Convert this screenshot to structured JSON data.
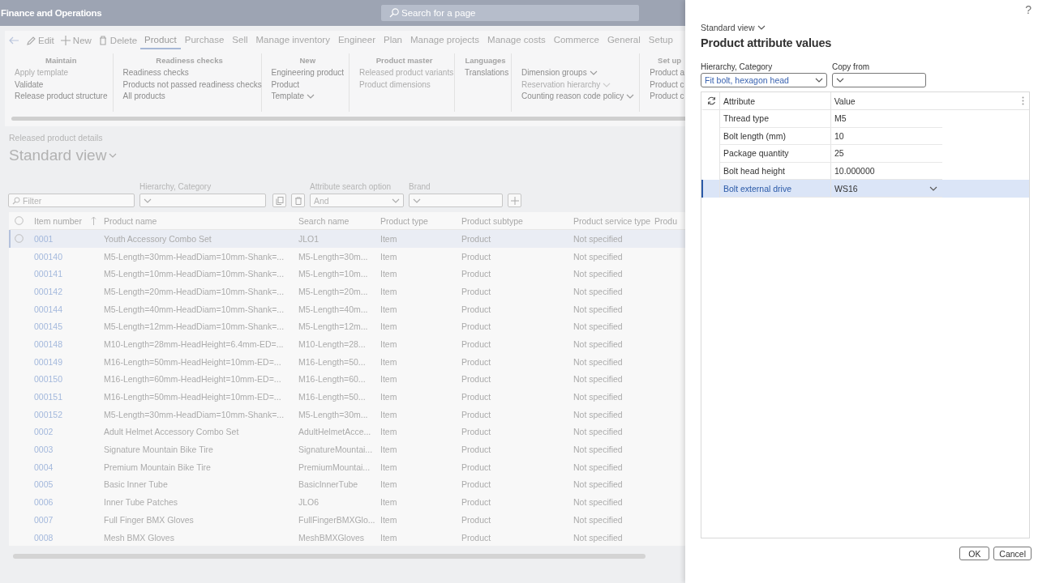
{
  "app": {
    "title": "Finance and Operations",
    "search_placeholder": "Search for a page"
  },
  "actions": [
    {
      "kind": "back",
      "disabled": true
    },
    {
      "kind": "edit",
      "label": "Edit",
      "disabled": true
    },
    {
      "kind": "new",
      "label": "New",
      "disabled": true
    },
    {
      "kind": "delete",
      "label": "Delete",
      "disabled": true
    }
  ],
  "tabs": [
    {
      "label": "Product",
      "selected": true
    },
    {
      "label": "Purchase",
      "selected": false
    },
    {
      "label": "Sell",
      "selected": false
    },
    {
      "label": "Manage inventory",
      "selected": false
    },
    {
      "label": "Engineer",
      "selected": false
    },
    {
      "label": "Plan",
      "selected": false
    },
    {
      "label": "Manage projects",
      "selected": false
    },
    {
      "label": "Manage costs",
      "selected": false
    },
    {
      "label": "Commerce",
      "selected": false
    },
    {
      "label": "General",
      "selected": false
    },
    {
      "label": "Setup",
      "selected": false
    }
  ],
  "ribbon_groups": [
    {
      "title": "Maintain",
      "items": [
        {
          "label": "Apply template",
          "disabled": true,
          "dropdown": false
        },
        {
          "label": "Validate",
          "disabled": false,
          "dropdown": false
        },
        {
          "label": "Release product structure",
          "disabled": false,
          "dropdown": false
        }
      ]
    },
    {
      "title": "Readiness checks",
      "items": [
        {
          "label": "Readiness checks",
          "disabled": false,
          "dropdown": false
        },
        {
          "label": "Products not passed readiness checks",
          "disabled": false,
          "dropdown": false
        },
        {
          "label": "All products",
          "disabled": false,
          "dropdown": false
        }
      ]
    },
    {
      "title": "New",
      "items": [
        {
          "label": "Engineering product",
          "disabled": false,
          "dropdown": false
        },
        {
          "label": "Product",
          "disabled": false,
          "dropdown": false
        },
        {
          "label": "Template",
          "disabled": false,
          "dropdown": true
        }
      ]
    },
    {
      "title": "Product master",
      "items": [
        {
          "label": "Released product variants",
          "disabled": true,
          "dropdown": false
        },
        {
          "label": "Product dimensions",
          "disabled": true,
          "dropdown": false
        }
      ]
    },
    {
      "title": "Languages",
      "items": [
        {
          "label": "Translations",
          "disabled": false,
          "dropdown": false
        }
      ]
    },
    {
      "items": [
        {
          "label": "Dimension groups",
          "disabled": false,
          "dropdown": true
        },
        {
          "label": "Reservation hierarchy",
          "disabled": true,
          "dropdown": true
        },
        {
          "label": "Counting reason code policy",
          "disabled": false,
          "dropdown": true
        }
      ]
    },
    {
      "title": "Set up",
      "items": [
        {
          "label": "Product a",
          "disabled": false,
          "dropdown": false
        },
        {
          "label": "Product c",
          "disabled": false,
          "dropdown": false
        },
        {
          "label": "Product c",
          "disabled": false,
          "dropdown": false
        }
      ]
    }
  ],
  "page": {
    "caption": "Released product details",
    "view": "Standard view"
  },
  "filters": {
    "filter_placeholder": "Filter",
    "hierarchy_label": "Hierarchy, Category",
    "attribute_option_label": "Attribute search option",
    "attribute_option_value": "And",
    "brand_label": "Brand"
  },
  "grid": {
    "columns": [
      "Item number",
      "Product name",
      "Search name",
      "Product type",
      "Product subtype",
      "Product service type",
      "Produ"
    ],
    "rows": [
      {
        "cells": [
          "0001",
          "Youth Accessory Combo Set",
          "JLO1",
          "Item",
          "Product",
          "Not specified"
        ],
        "selected": true
      },
      {
        "cells": [
          "000140",
          "M5-Length=30mm-HeadDiam=10mm-Shank=...",
          "M5-Length=30m...",
          "Item",
          "Product",
          "Not specified"
        ],
        "selected": false
      },
      {
        "cells": [
          "000141",
          "M5-Length=10mm-HeadDiam=10mm-Shank=...",
          "M5-Length=10m...",
          "Item",
          "Product",
          "Not specified"
        ],
        "selected": false
      },
      {
        "cells": [
          "000142",
          "M5-Length=20mm-HeadDiam=10mm-Shank=...",
          "M5-Length=20m...",
          "Item",
          "Product",
          "Not specified"
        ],
        "selected": false
      },
      {
        "cells": [
          "000144",
          "M5-Length=40mm-HeadDiam=10mm-Shank=...",
          "M5-Length=40m...",
          "Item",
          "Product",
          "Not specified"
        ],
        "selected": false
      },
      {
        "cells": [
          "000145",
          "M5-Length=12mm-HeadDiam=10mm-Shank=...",
          "M5-Length=12m...",
          "Item",
          "Product",
          "Not specified"
        ],
        "selected": false
      },
      {
        "cells": [
          "000148",
          "M10-Length=28mm-HeadHeight=6.4mm-ED=...",
          "M10-Length=28...",
          "Item",
          "Product",
          "Not specified"
        ],
        "selected": false
      },
      {
        "cells": [
          "000149",
          "M16-Length=50mm-HeadHeight=10mm-ED=...",
          "M16-Length=50...",
          "Item",
          "Product",
          "Not specified"
        ],
        "selected": false
      },
      {
        "cells": [
          "000150",
          "M16-Length=60mm-HeadHeight=10mm-ED=...",
          "M16-Length=60...",
          "Item",
          "Product",
          "Not specified"
        ],
        "selected": false
      },
      {
        "cells": [
          "000151",
          "M16-Length=50mm-HeadHeight=10mm-ED=...",
          "M16-Length=50...",
          "Item",
          "Product",
          "Not specified"
        ],
        "selected": false
      },
      {
        "cells": [
          "000152",
          "M5-Length=30mm-HeadDiam=10mm-Shank=...",
          "M5-Length=30m...",
          "Item",
          "Product",
          "Not specified"
        ],
        "selected": false
      },
      {
        "cells": [
          "0002",
          "Adult Helmet Accessory Combo Set",
          "AdultHelmetAcce...",
          "Item",
          "Product",
          "Not specified"
        ],
        "selected": false
      },
      {
        "cells": [
          "0003",
          "Signature Mountain Bike Tire",
          "SignatureMountai...",
          "Item",
          "Product",
          "Not specified"
        ],
        "selected": false
      },
      {
        "cells": [
          "0004",
          "Premium Mountain Bike Tire",
          "PremiumMountai...",
          "Item",
          "Product",
          "Not specified"
        ],
        "selected": false
      },
      {
        "cells": [
          "0005",
          "Basic Inner Tube",
          "BasicInnerTube",
          "Item",
          "Product",
          "Not specified"
        ],
        "selected": false
      },
      {
        "cells": [
          "0006",
          "Inner Tube Patches",
          "JLO6",
          "Item",
          "Product",
          "Not specified"
        ],
        "selected": false
      },
      {
        "cells": [
          "0007",
          "Full Finger BMX Gloves",
          "FullFingerBMXGlo...",
          "Item",
          "Product",
          "Not specified"
        ],
        "selected": false
      },
      {
        "cells": [
          "0008",
          "Mesh BMX Gloves",
          "MeshBMXGloves",
          "Item",
          "Product",
          "Not specified"
        ],
        "selected": false
      }
    ]
  },
  "panel": {
    "help": "?",
    "view": "Standard view",
    "title": "Product attribute values",
    "hierarchy": {
      "label": "Hierarchy, Category",
      "value": "Fit bolt, hexagon head"
    },
    "copy_from": {
      "label": "Copy from"
    },
    "columns": [
      "Attribute",
      "Value"
    ],
    "rows": [
      {
        "attribute": "Thread type",
        "value": "M5",
        "selected": false
      },
      {
        "attribute": "Bolt length (mm)",
        "value": "10",
        "selected": false
      },
      {
        "attribute": "Package quantity",
        "value": "25",
        "selected": false
      },
      {
        "attribute": "Bolt head height",
        "value": "10.000000",
        "selected": false
      },
      {
        "attribute": "Bolt external drive",
        "value": "WS16",
        "selected": true
      }
    ],
    "buttons": [
      "OK",
      "Cancel"
    ]
  }
}
